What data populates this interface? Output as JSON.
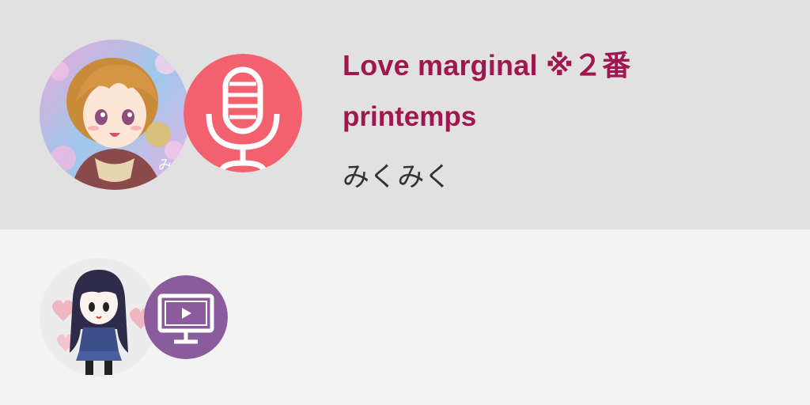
{
  "items": [
    {
      "title": "Love marginal ※２番",
      "artist": "printemps",
      "uploader": "みくみく",
      "badge_icon": "microphone-icon",
      "badge_color": "#f3606e",
      "avatar_art": "anime-girl-orange-hair-illustration"
    },
    {
      "title": "",
      "artist": "",
      "uploader": "",
      "badge_icon": "video-monitor-icon",
      "badge_color": "#8a5c9c",
      "avatar_art": "anime-girl-dark-hair-illustration"
    }
  ],
  "colors": {
    "title": "#a0174f",
    "selected_row_bg": "#e1e1e1",
    "row_bg": "#f3f3f3"
  }
}
